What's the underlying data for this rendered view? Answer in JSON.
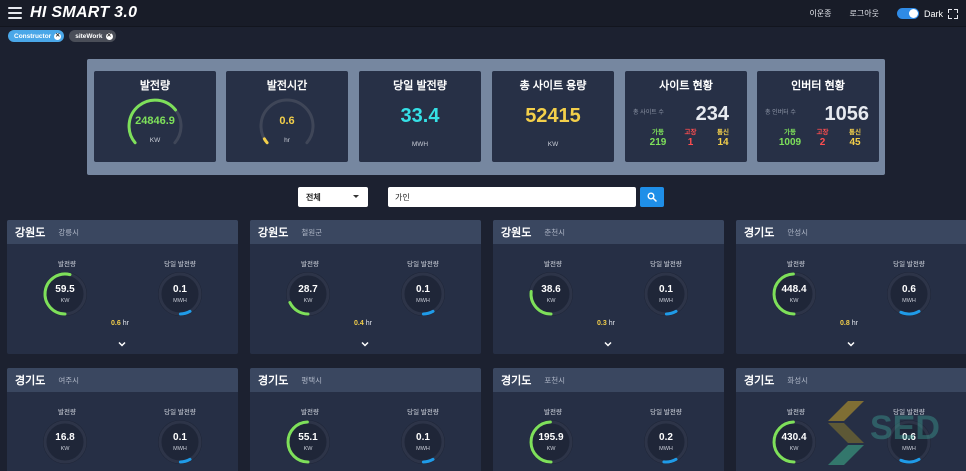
{
  "app": {
    "title": "HI SMART 3.0"
  },
  "topbar": {
    "user": "이운종",
    "logout": "로그아웃",
    "theme_label": "Dark"
  },
  "filters_chips": [
    {
      "label": "Constructor"
    },
    {
      "label": "siteWork"
    }
  ],
  "summary": {
    "generation": {
      "title": "발전량",
      "value": "24846.9",
      "unit": "KW",
      "gauge_fraction": 0.7
    },
    "gen_time": {
      "title": "발전시간",
      "value": "0.6",
      "unit": "hr",
      "gauge_fraction": 0.04
    },
    "daily_gen": {
      "title": "당일 발전량",
      "value": "33.4",
      "unit": "MWH"
    },
    "total_capacity": {
      "title": "총 사이트 용량",
      "value": "52415",
      "unit": "KW"
    },
    "site_status": {
      "title": "사이트 현황",
      "total_label": "총 사이트 수",
      "total": "234",
      "stats": [
        {
          "label": "가동",
          "value": "219"
        },
        {
          "label": "고장",
          "value": "1"
        },
        {
          "label": "통신",
          "value": "14"
        }
      ]
    },
    "inverter_status": {
      "title": "인버터 현황",
      "total_label": "총 인버터 수",
      "total": "1056",
      "stats": [
        {
          "label": "가동",
          "value": "1009"
        },
        {
          "label": "고장",
          "value": "2"
        },
        {
          "label": "통신",
          "value": "45"
        }
      ]
    }
  },
  "search": {
    "select_value": "전체",
    "query": "가인"
  },
  "sites": [
    {
      "province": "강원도",
      "city": "강릉시",
      "gen_label": "발전량",
      "gen": "59.5",
      "gen_unit": "KW",
      "gen_fraction": 0.6,
      "daily_label": "당일 발전량",
      "daily": "0.1",
      "daily_unit": "MWH",
      "daily_fraction": 0.08,
      "hours": "0.6",
      "hours_unit": "hr"
    },
    {
      "province": "강원도",
      "city": "철원군",
      "gen_label": "발전량",
      "gen": "28.7",
      "gen_unit": "KW",
      "gen_fraction": 0.2,
      "daily_label": "당일 발전량",
      "daily": "0.1",
      "daily_unit": "MWH",
      "daily_fraction": 0.08,
      "hours": "0.4",
      "hours_unit": "hr"
    },
    {
      "province": "강원도",
      "city": "춘천시",
      "gen_label": "발전량",
      "gen": "38.6",
      "gen_unit": "KW",
      "gen_fraction": 0.3,
      "daily_label": "당일 발전량",
      "daily": "0.1",
      "daily_unit": "MWH",
      "daily_fraction": 0.08,
      "hours": "0.3",
      "hours_unit": "hr"
    },
    {
      "province": "경기도",
      "city": "안성시",
      "gen_label": "발전량",
      "gen": "448.4",
      "gen_unit": "KW",
      "gen_fraction": 0.55,
      "daily_label": "당일 발전량",
      "daily": "0.6",
      "daily_unit": "MWH",
      "daily_fraction": 0.15,
      "hours": "0.8",
      "hours_unit": "hr"
    },
    {
      "province": "경기도",
      "city": "여주시",
      "gen_label": "발전량",
      "gen": "16.8",
      "gen_unit": "KW",
      "gen_fraction": 0.0,
      "daily_label": "당일 발전량",
      "daily": "0.1",
      "daily_unit": "MWH",
      "daily_fraction": 0.08
    },
    {
      "province": "경기도",
      "city": "평택시",
      "gen_label": "발전량",
      "gen": "55.1",
      "gen_unit": "KW",
      "gen_fraction": 0.55,
      "daily_label": "당일 발전량",
      "daily": "0.1",
      "daily_unit": "MWH",
      "daily_fraction": 0.08
    },
    {
      "province": "경기도",
      "city": "포천시",
      "gen_label": "발전량",
      "gen": "195.9",
      "gen_unit": "KW",
      "gen_fraction": 0.55,
      "daily_label": "당일 발전량",
      "daily": "0.2",
      "daily_unit": "MWH",
      "daily_fraction": 0.1
    },
    {
      "province": "경기도",
      "city": "화성시",
      "gen_label": "발전량",
      "gen": "430.4",
      "gen_unit": "KW",
      "gen_fraction": 0.55,
      "daily_label": "당일 발전량",
      "daily": "0.6",
      "daily_unit": "MWH",
      "daily_fraction": 0.15
    }
  ],
  "colors": {
    "green": "#7ee05a",
    "yellow": "#f3cf4a",
    "cyan": "#35e0e6",
    "blue": "#1f9be8",
    "red": "#ff4d4f",
    "track": "#3f4658"
  },
  "icons": [
    "menu-icon",
    "fullscreen-icon",
    "close-icon",
    "search-icon",
    "chevron-down-icon"
  ]
}
